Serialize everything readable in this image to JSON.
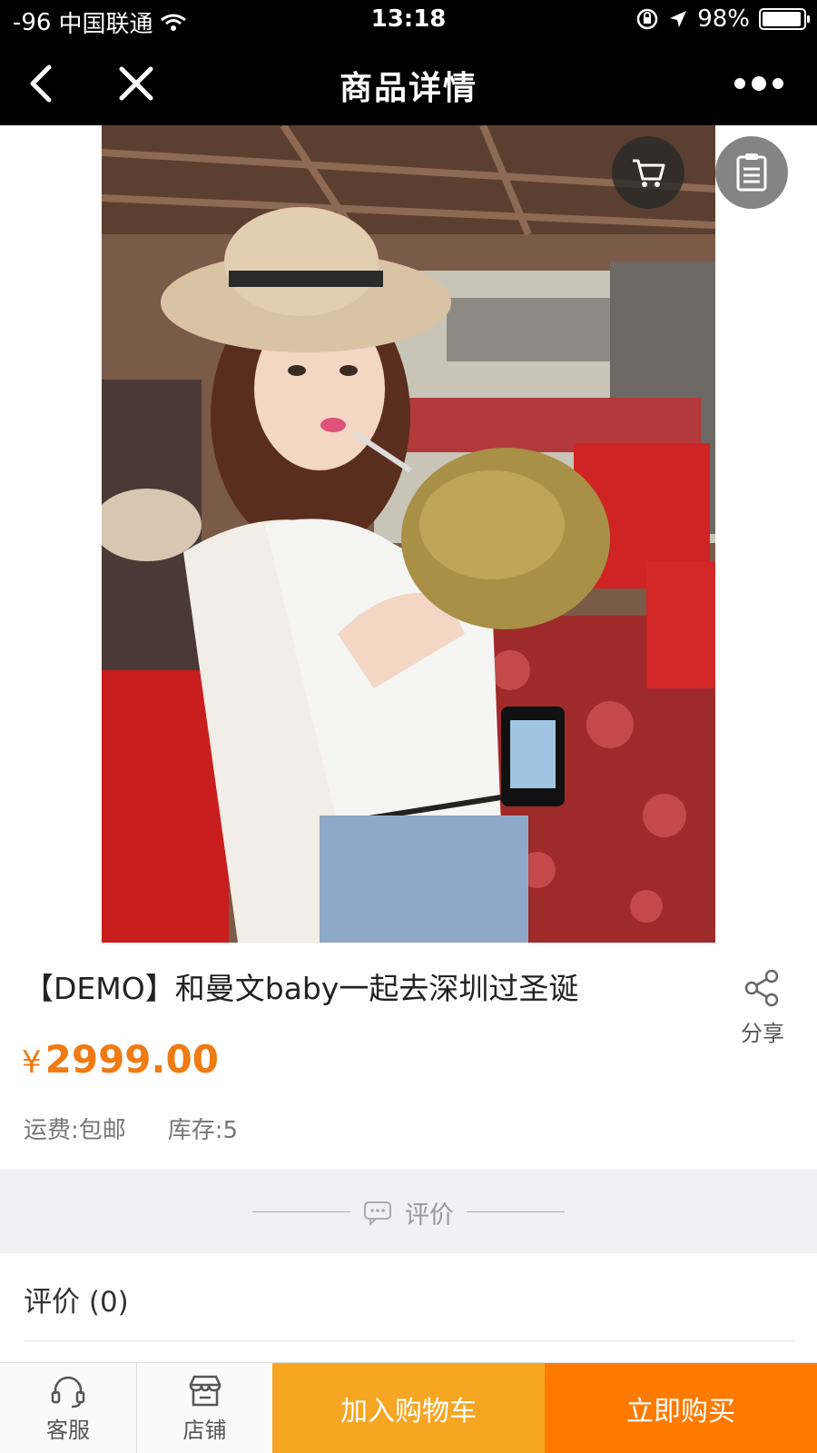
{
  "status_bar": {
    "signal": "-96",
    "carrier": "中国联通",
    "time": "13:18",
    "battery": "98%"
  },
  "nav": {
    "title": "商品详情",
    "back_icon": "chevron-left-icon",
    "close_icon": "close-icon",
    "more_icon": "more-dots-icon"
  },
  "hero": {
    "cart_icon": "cart-icon",
    "list_icon": "list-icon"
  },
  "product": {
    "title": "【DEMO】和曼文baby一起去深圳过圣诞",
    "price_symbol": "¥",
    "price": "2999.00",
    "shipping": "运费:包邮",
    "stock": "库存:5",
    "share_label": "分享"
  },
  "reviews": {
    "divider_label": "评价",
    "count_label": "评价 (0)"
  },
  "bottom_bar": {
    "service_label": "客服",
    "store_label": "店铺",
    "add_to_cart_label": "加入购物车",
    "buy_now_label": "立即购买"
  },
  "colors": {
    "price": "#f07a13",
    "add_to_cart": "#f6a623",
    "buy_now": "#ff7a00",
    "nav_bg": "#000000"
  }
}
